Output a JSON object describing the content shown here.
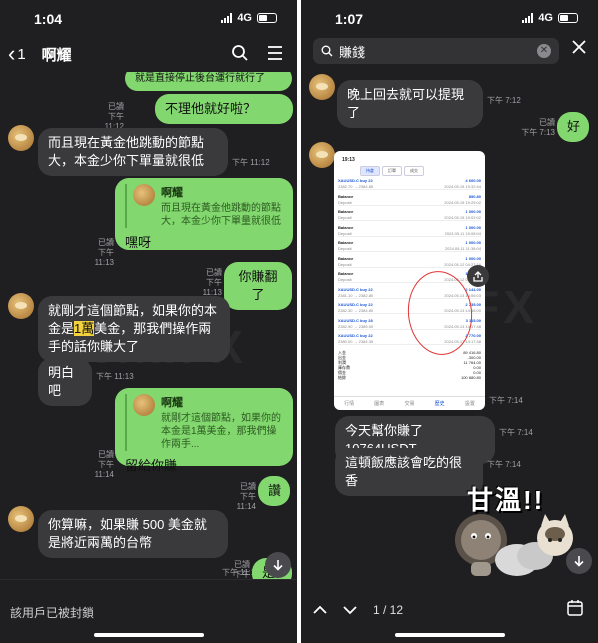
{
  "left": {
    "status": {
      "time": "1:04",
      "network": "4G"
    },
    "header": {
      "unread_count": "1",
      "title": "啊耀"
    },
    "messages": {
      "m1_text": "就是直接停止後台運行就行了",
      "m2_text": "不理他就好啦？",
      "m2_read": "已讀",
      "m2_time": "下午 11:12",
      "m3_text": "而且現在黃金他跳動的節點大，本金少你下單量就很低",
      "m3_time": "下午 11:12",
      "m4_quote_name": "啊耀",
      "m4_quote_text": "而且現在黃金他跳動的節點大，本金少你下單量就很低",
      "m4_text": "嘿呀",
      "m4_read": "已讀",
      "m4_time": "下午 11:13",
      "m5_text": "你賺翻了",
      "m5_read": "已讀",
      "m5_time": "下午 11:13",
      "m6_text_a": "就剛才這個節點，如果你的本金是",
      "m6_text_hl": "1萬",
      "m6_text_b": "美金，那我們操作兩手的話你賺大了",
      "m7_text": "明白吧",
      "m7_time": "下午 11:13",
      "m8_quote_name": "啊耀",
      "m8_quote_text": "就剛才這個節點，如果你的本金是1萬美金，那我們操作兩手...",
      "m8_text": "留給你賺",
      "m8_read": "已讀",
      "m8_time": "下午 11:14",
      "m9_text": "讚",
      "m9_read": "已讀",
      "m9_time": "下午 11:14",
      "m10_text": "你算嘛，如果賺 500 美金就是將近兩萬的台幣",
      "m10_time": "下午 11:15",
      "m11_text": "是",
      "m11_read": "已讀",
      "m11_time": "下午 11:15"
    },
    "footer": {
      "blocked_text": "該用戶已被封鎖"
    }
  },
  "right": {
    "status": {
      "time": "1:07",
      "network": "4G"
    },
    "search": {
      "value": "賺錢"
    },
    "messages": {
      "r1_text": "晚上回去就可以提現了",
      "r1_time": "下午 7:12",
      "r2_text": "好",
      "r2_read": "已讀",
      "r2_time": "下午 7:13",
      "r3_time": "下午 7:14",
      "r4_text": "今天幫你賺了 10764USDT",
      "r4_time": "下午 7:14",
      "r5_text": "這頓飯應該會吃的很香",
      "r5_time": "下午 7:14"
    },
    "sticker_text": "甘溫!!",
    "pager": {
      "label": "1 / 12"
    },
    "screenshot": {
      "time": "19:13",
      "tabs": [
        "持倉",
        "訂單",
        "成交"
      ],
      "rows": [
        {
          "k": "XAUUSD.C buy 22",
          "sub": "2382.70 → 2384.85",
          "v": "4 600.00",
          "d": "2024.05.15 19:32:44"
        },
        {
          "k": "Balance",
          "sub": "Deposit",
          "v": "890.80",
          "d": "2024.05.15 19:25:02"
        },
        {
          "k": "Balance",
          "sub": "Deposit",
          "v": "1 000.00",
          "d": "2024.05.15 15:02:02"
        },
        {
          "k": "Balance",
          "sub": "Deposit",
          "v": "1 000.00",
          "d": "2024.05.11 15:08:04"
        },
        {
          "k": "Balance",
          "sub": "Deposit",
          "v": "1 000.00",
          "d": "2024.05.11 11:38:04"
        },
        {
          "k": "Balance",
          "sub": "Deposit",
          "v": "1 000.00",
          "d": "2024.05.12 04:27:16"
        },
        {
          "k": "Balance",
          "sub": "Deposit",
          "v": "1 000.00",
          "d": "2024.05.12 04:32:14"
        },
        {
          "k": "XAUUSD.C buy 22",
          "sub": "2381.10 → 2382.80",
          "v": "2 144.00",
          "d": "2024.05.13 14:55:03"
        },
        {
          "k": "XAUUSD.C buy 22",
          "sub": "2382.30 → 2384.80",
          "v": "2 735.00",
          "d": "2024.05.13 14:18:00"
        },
        {
          "k": "XAUUSD.C buy 28",
          "sub": "2382.90 → 2385.00",
          "v": "3 115.00",
          "d": "2024.05.13 14:17:48"
        },
        {
          "k": "XAUUSD.C buy 22",
          "sub": "2380.00 → 2384.35",
          "v": "2 770.00",
          "d": "2024.05.13 14:17:48"
        }
      ],
      "sums": [
        {
          "k": "入金",
          "v": "89 416.80"
        },
        {
          "k": "出金",
          "v": "-300.00"
        },
        {
          "k": "利潤",
          "v": "11 764.00"
        },
        {
          "k": "庫存費",
          "v": "0.00"
        },
        {
          "k": "佣金",
          "v": "0.00"
        },
        {
          "k": "結餘",
          "v": "100 880.80"
        }
      ],
      "nav": [
        "行情",
        "圖表",
        "交易",
        "歷史",
        "設置"
      ]
    }
  },
  "colors": {
    "bg": "#1f1f21",
    "incoming": "#3a3a3d",
    "outgoing": "#82d86f",
    "highlight": "#f2d33d"
  }
}
